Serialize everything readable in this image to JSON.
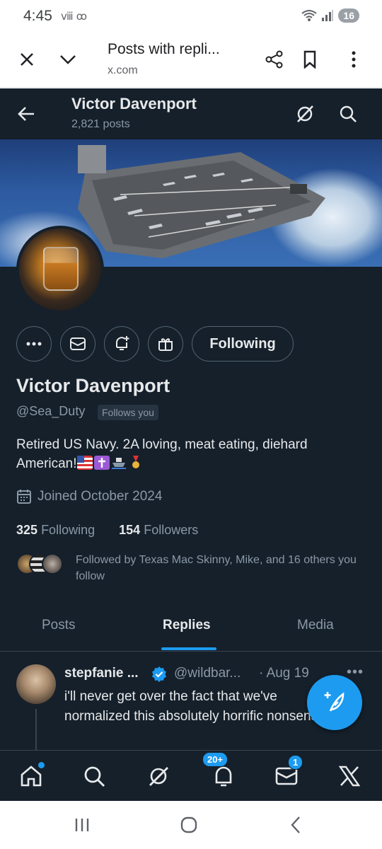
{
  "status_bar": {
    "time": "4:45",
    "battery": "16",
    "left_icons": "ⅷ ꝏ"
  },
  "browser": {
    "page_title": "Posts with repli...",
    "domain": "x.com"
  },
  "header": {
    "name": "Victor Davenport",
    "post_count": "2,821 posts"
  },
  "profile": {
    "display_name": "Victor Davenport",
    "handle": "@Sea_Duty",
    "follows_you": "Follows you",
    "bio_text": "Retired US Navy. 2A loving, meat eating, diehard American!",
    "joined": "Joined October 2024",
    "following_count": "325",
    "following_label": "Following",
    "followers_count": "154",
    "followers_label": "Followers",
    "followed_by": "Followed by Texas Mac Skinny, Mike, and 16 others you follow",
    "follow_button": "Following"
  },
  "tabs": [
    "Posts",
    "Replies",
    "Media"
  ],
  "active_tab": "Replies",
  "post": {
    "author_name": "stepfanie ...",
    "author_handle": "@wildbar...",
    "date": "· Aug 19",
    "text": "i'll never get over the fact that we've normalized this absolutely horrific nonsense"
  },
  "bottom_nav": {
    "notifications_badge": "20+",
    "messages_badge": "1"
  },
  "colors": {
    "background": "#15202b",
    "accent": "#1d9bf0",
    "text": "#e7e9ea",
    "muted": "#8b98a5",
    "border": "#38444d"
  }
}
